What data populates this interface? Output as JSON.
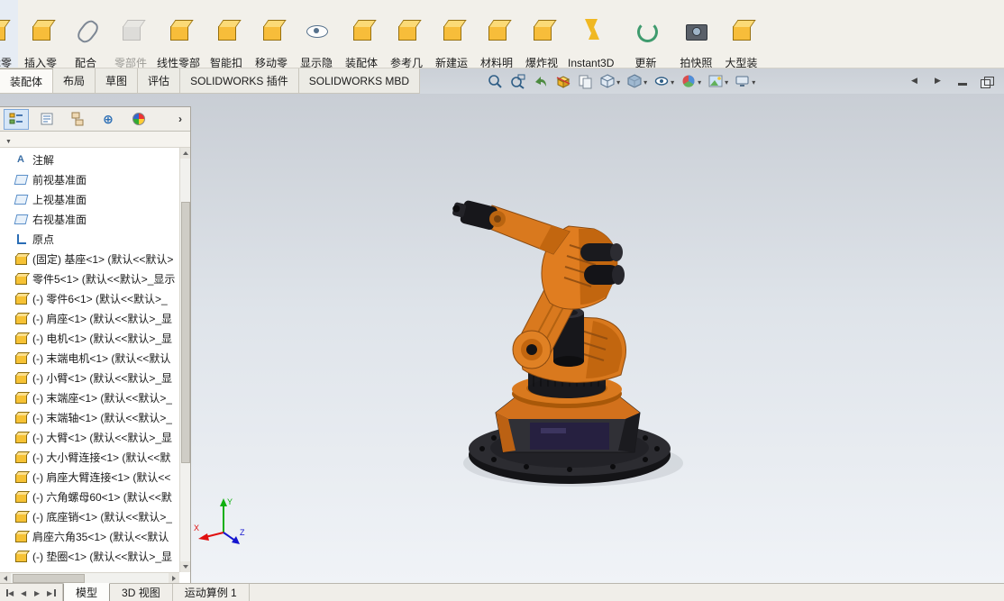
{
  "colors": {
    "selection_blue": "#d6e6f7",
    "robot_orange": "#d9791e",
    "viewport_gradient_top": "#c9ced5",
    "viewport_gradient_bottom": "#f0f3f7",
    "axis_x_red": "#e01010",
    "axis_y_green": "#0faf0f",
    "axis_z_blue": "#1414cf"
  },
  "ribbon": {
    "buttons": [
      {
        "label": "编辑零\n部件",
        "icon": "cube",
        "clipped": true
      },
      {
        "label": "插入零\n部件",
        "icon": "cube",
        "dropdown": true
      },
      {
        "label": "配合",
        "icon": "paperclip"
      },
      {
        "label": "零部件\n预览窗",
        "icon": "cube",
        "disabled": true
      },
      {
        "label": "线性零部\n件阵列",
        "icon": "cube"
      },
      {
        "label": "智能扣\n件",
        "icon": "cube"
      },
      {
        "label": "移动零\n部件",
        "icon": "cube",
        "dropdown": true
      },
      {
        "label": "显示隐\n藏的零\n部件",
        "icon": "showhide"
      },
      {
        "label": "装配体\n特征",
        "icon": "cube",
        "dropdown": true
      },
      {
        "label": "参考几\n何体",
        "icon": "cube",
        "dropdown": true
      },
      {
        "label": "新建运\n动算例",
        "icon": "cube"
      },
      {
        "label": "材料明\n细表",
        "icon": "cube",
        "dropdown": true
      },
      {
        "label": "爆炸视\n图",
        "icon": "cube",
        "dropdown": true
      },
      {
        "label": "Instant3D",
        "icon": "instant3d"
      },
      {
        "label": "更新\nSpeedpak",
        "icon": "speedpak"
      },
      {
        "label": "拍快照",
        "icon": "camera"
      },
      {
        "label": "大型装\n配体模\n式",
        "icon": "cube"
      }
    ]
  },
  "command_tabs": [
    {
      "label": "装配体",
      "active": true
    },
    {
      "label": "布局"
    },
    {
      "label": "草图"
    },
    {
      "label": "评估"
    },
    {
      "label": "SOLIDWORKS 插件"
    },
    {
      "label": "SOLIDWORKS MBD"
    }
  ],
  "feature_tree": {
    "items": [
      {
        "icon": "annotation",
        "label": "注解"
      },
      {
        "icon": "plane",
        "label": "前视基准面"
      },
      {
        "icon": "plane",
        "label": "上视基准面"
      },
      {
        "icon": "plane",
        "label": "右视基准面"
      },
      {
        "icon": "origin",
        "label": "原点"
      },
      {
        "icon": "part",
        "label": "(固定) 基座<1> (默认<<默认>"
      },
      {
        "icon": "part",
        "label": "零件5<1> (默认<<默认>_显示"
      },
      {
        "icon": "part",
        "label": "(-) 零件6<1> (默认<<默认>_"
      },
      {
        "icon": "part",
        "label": "(-) 肩座<1> (默认<<默认>_显"
      },
      {
        "icon": "part",
        "label": "(-) 电机<1> (默认<<默认>_显"
      },
      {
        "icon": "part",
        "label": "(-) 末端电机<1> (默认<<默认"
      },
      {
        "icon": "part",
        "label": "(-) 小臂<1> (默认<<默认>_显"
      },
      {
        "icon": "part",
        "label": "(-) 末端座<1> (默认<<默认>_"
      },
      {
        "icon": "part",
        "label": "(-) 末端轴<1> (默认<<默认>_"
      },
      {
        "icon": "part",
        "label": "(-) 大臂<1> (默认<<默认>_显"
      },
      {
        "icon": "part",
        "label": "(-) 大小臂连接<1> (默认<<默"
      },
      {
        "icon": "part",
        "label": "(-) 肩座大臂连接<1> (默认<<"
      },
      {
        "icon": "part",
        "label": "(-) 六角螺母60<1> (默认<<默"
      },
      {
        "icon": "part",
        "label": "(-) 底座销<1> (默认<<默认>_"
      },
      {
        "icon": "part",
        "label": "肩座六角35<1> (默认<<默认"
      },
      {
        "icon": "part",
        "label": "(-) 垫圈<1> (默认<<默认>_显"
      }
    ]
  },
  "viewport": {
    "triad": {
      "x": "X",
      "y": "Y",
      "z": "Z"
    }
  },
  "bottom_bar": {
    "tabs": [
      {
        "label": "模型",
        "active": true
      },
      {
        "label": "3D 视图"
      },
      {
        "label": "运动算例 1"
      }
    ]
  }
}
